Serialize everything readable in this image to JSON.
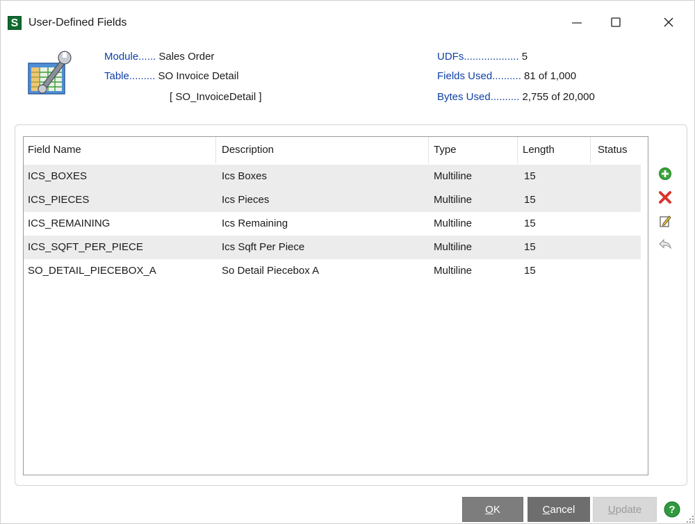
{
  "window": {
    "app_icon_letter": "S",
    "title": "User-Defined Fields"
  },
  "info": {
    "module_label": "Module......",
    "module_value": "Sales Order",
    "table_label": "Table.........",
    "table_value": "SO Invoice Detail",
    "table_internal": "[ SO_InvoiceDetail ]",
    "udfs_label": "UDFs...................",
    "udfs_value": "5",
    "fields_used_label": "Fields Used..........",
    "fields_used_value": "81 of 1,000",
    "bytes_used_label": "Bytes Used..........",
    "bytes_used_value": "2,755 of 20,000"
  },
  "grid": {
    "columns": [
      "Field Name",
      "Description",
      "Type",
      "Length",
      "Status"
    ],
    "rows": [
      {
        "field_name": "ICS_BOXES",
        "description": "Ics Boxes",
        "type": "Multiline",
        "length": "15",
        "status": ""
      },
      {
        "field_name": "ICS_PIECES",
        "description": "Ics Pieces",
        "type": "Multiline",
        "length": "15",
        "status": ""
      },
      {
        "field_name": "ICS_REMAINING",
        "description": "Ics Remaining",
        "type": "Multiline",
        "length": "15",
        "status": ""
      },
      {
        "field_name": "ICS_SQFT_PER_PIECE",
        "description": "Ics Sqft Per Piece",
        "type": "Multiline",
        "length": "15",
        "status": ""
      },
      {
        "field_name": "SO_DETAIL_PIECEBOX_A",
        "description": "So Detail Piecebox A",
        "type": "Multiline",
        "length": "15",
        "status": ""
      }
    ]
  },
  "tools": {
    "icons": [
      "add-icon",
      "delete-icon",
      "edit-icon",
      "undo-icon"
    ]
  },
  "buttons": {
    "ok_accel": "O",
    "ok_rest": "K",
    "cancel_accel": "C",
    "cancel_rest": "ancel",
    "update_accel": "U",
    "update_rest": "pdate"
  },
  "colors": {
    "info_label": "#0d3fa8",
    "row_alt": "#ececec",
    "button_active": "#7d7d7d",
    "button_disabled": "#d8d8d8",
    "app_icon": "#0e6b2e"
  }
}
